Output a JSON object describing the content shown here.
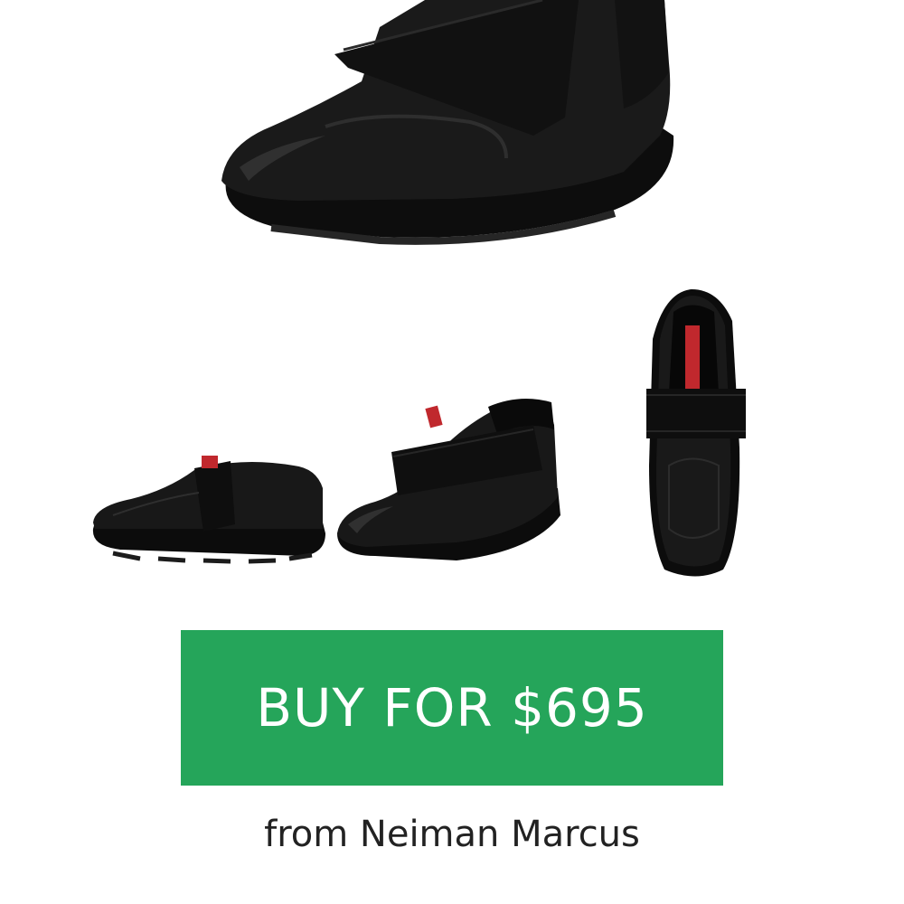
{
  "product": {
    "images": [
      {
        "name": "main-view-icon",
        "view": "three-quarter front"
      },
      {
        "name": "side-view-icon",
        "view": "side"
      },
      {
        "name": "front-view-icon",
        "view": "three-quarter"
      },
      {
        "name": "top-view-icon",
        "view": "top"
      }
    ],
    "buy_label": "BUY FOR $695",
    "retailer_label": "from Neiman Marcus"
  },
  "colors": {
    "button_bg": "#25a55a",
    "button_text": "#ffffff",
    "accent_tab": "#c0282d",
    "shoe": "#151515"
  }
}
